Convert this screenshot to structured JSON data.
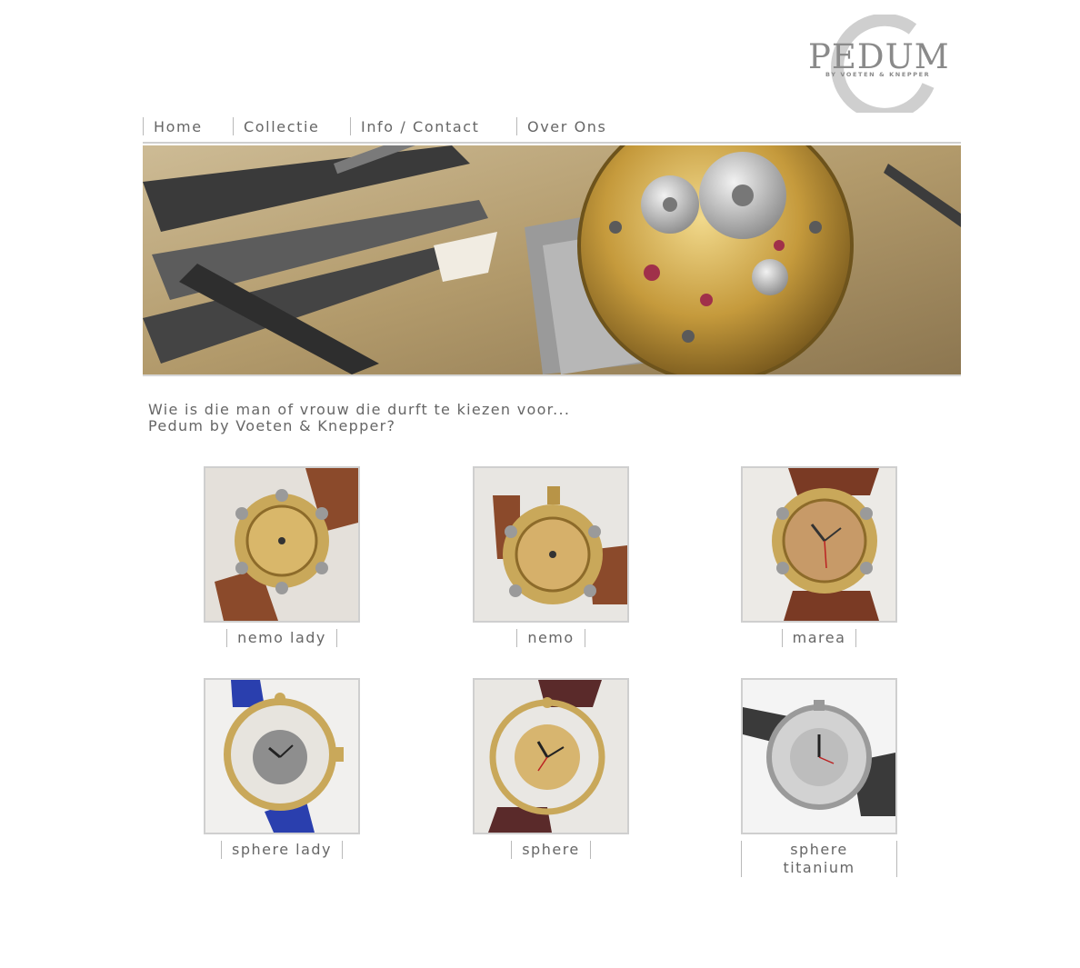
{
  "logo": {
    "brand": "PEDUM",
    "subtitle": "BY VOETEN & KNEPPER"
  },
  "nav": {
    "items": [
      {
        "label": "Home"
      },
      {
        "label": "Collectie"
      },
      {
        "label": "Info / Contact"
      },
      {
        "label": "Over Ons"
      }
    ]
  },
  "intro": {
    "line1": "Wie is die man of vrouw die durft te kiezen voor...",
    "line2": "Pedum by Voeten & Knepper?"
  },
  "products": [
    {
      "name": "nemo lady"
    },
    {
      "name": "nemo"
    },
    {
      "name": "marea"
    },
    {
      "name": "sphere lady"
    },
    {
      "name": "sphere"
    },
    {
      "name": "sphere titanium"
    }
  ],
  "colors": {
    "text": "#666666",
    "divider": "#b9b9b9",
    "border": "#cfcfcf",
    "gold": "#c9a85a"
  }
}
